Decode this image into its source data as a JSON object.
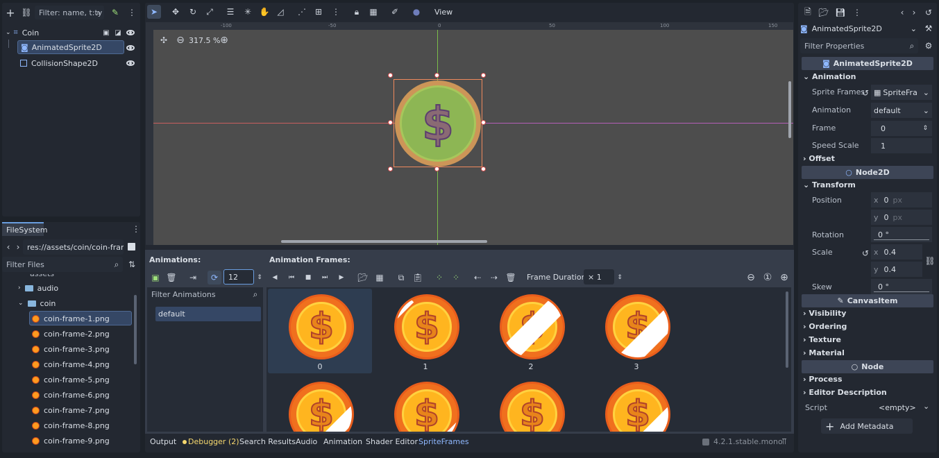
{
  "scene_panel": {
    "filter_placeholder": "Filter: name, t:ty",
    "nodes": [
      {
        "label": "Coin"
      },
      {
        "label": "AnimatedSprite2D"
      },
      {
        "label": "CollisionShape2D"
      }
    ]
  },
  "filesystem": {
    "title": "FileSystem",
    "path": "res://assets/coin/coin-frame-",
    "filter_placeholder": "Filter Files",
    "partial_top": "assets",
    "folders": [
      "audio",
      "coin"
    ],
    "files": [
      "coin-frame-1.png",
      "coin-frame-2.png",
      "coin-frame-3.png",
      "coin-frame-4.png",
      "coin-frame-5.png",
      "coin-frame-6.png",
      "coin-frame-7.png",
      "coin-frame-8.png",
      "coin-frame-9.png"
    ]
  },
  "toolbar": {
    "view_label": "View"
  },
  "viewport": {
    "zoom": "317.5 %",
    "ruler_labels": [
      "-100",
      "-50",
      "0",
      "50",
      "100",
      "150"
    ]
  },
  "animations_panel": {
    "title": "Animations:",
    "fps": "12",
    "filter_placeholder": "Filter Animations",
    "items": [
      "default"
    ]
  },
  "frames_panel": {
    "title": "Animation Frames:",
    "duration_label": "Frame Duration:",
    "duration_value": "× 1",
    "frames": [
      {
        "label": "0"
      },
      {
        "label": "1"
      },
      {
        "label": "2"
      },
      {
        "label": "3"
      },
      {
        "label": ""
      },
      {
        "label": ""
      },
      {
        "label": ""
      },
      {
        "label": ""
      }
    ]
  },
  "bottom_tabs": {
    "output": "Output",
    "debugger": "Debugger (2)",
    "search": "Search Results",
    "audio": "Audio",
    "animation": "Animation",
    "shader": "Shader Editor",
    "spriteframes": "SpriteFrames",
    "version": "4.2.1.stable.mono"
  },
  "inspector": {
    "node_type": "AnimatedSprite2D",
    "filter_placeholder": "Filter Properties",
    "header": "AnimatedSprite2D",
    "animation_section": "Animation",
    "sprite_frames_label": "Sprite Frames",
    "sprite_frames_value": "SpriteFra",
    "animation_label": "Animation",
    "animation_value": "default",
    "frame_label": "Frame",
    "frame_value": "0",
    "speed_label": "Speed Scale",
    "speed_value": "1",
    "offset_section": "Offset",
    "node2d_header": "Node2D",
    "transform_section": "Transform",
    "position_label": "Position",
    "pos_x": "0",
    "pos_y": "0",
    "px_unit": "px",
    "rotation_label": "Rotation",
    "rotation_value": "0 °",
    "scale_label": "Scale",
    "scale_x": "0.4",
    "scale_y": "0.4",
    "skew_label": "Skew",
    "skew_value": "0 °",
    "canvasitem_header": "CanvasItem",
    "visibility": "Visibility",
    "ordering": "Ordering",
    "texture": "Texture",
    "material": "Material",
    "node_header": "Node",
    "process": "Process",
    "editor_description": "Editor Description",
    "script_label": "Script",
    "script_value": "<empty>",
    "add_metadata": "Add Metadata",
    "x_axis": "x",
    "y_axis": "y"
  }
}
